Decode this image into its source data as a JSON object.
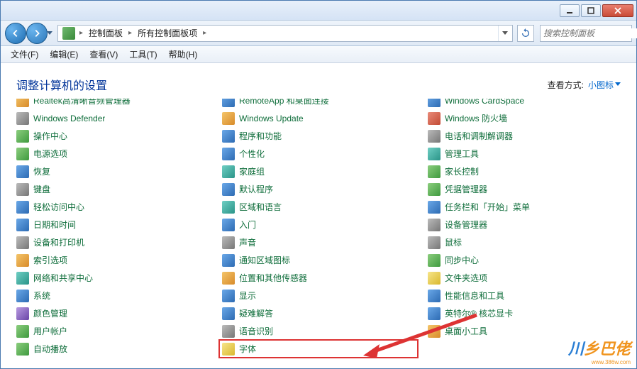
{
  "titlebar": {
    "minimize": "–",
    "maximize": "□",
    "close": "×"
  },
  "nav": {
    "crumb1": "控制面板",
    "crumb2": "所有控制面板项",
    "search_placeholder": "搜索控制面板"
  },
  "menu": {
    "file": "文件(F)",
    "edit": "编辑(E)",
    "view": "查看(V)",
    "tools": "工具(T)",
    "help": "帮助(H)"
  },
  "header": {
    "title": "调整计算机的设置",
    "viewlabel": "查看方式:",
    "viewmode": "小图标"
  },
  "items": [
    {
      "label": "Realtek高清晰音频管理器",
      "icon": "ic-orange",
      "name": "item-realtek-audio"
    },
    {
      "label": "RemoteApp 和桌面连接",
      "icon": "ic-blue",
      "name": "item-remoteapp"
    },
    {
      "label": "Windows CardSpace",
      "icon": "ic-blue",
      "name": "item-cardspace"
    },
    {
      "label": "Windows Defender",
      "icon": "ic-gray",
      "name": "item-defender"
    },
    {
      "label": "Windows Update",
      "icon": "ic-orange",
      "name": "item-update"
    },
    {
      "label": "Windows 防火墙",
      "icon": "ic-red",
      "name": "item-firewall"
    },
    {
      "label": "操作中心",
      "icon": "ic-green",
      "name": "item-action-center"
    },
    {
      "label": "程序和功能",
      "icon": "ic-blue",
      "name": "item-programs"
    },
    {
      "label": "电话和调制解调器",
      "icon": "ic-gray",
      "name": "item-phone-modem"
    },
    {
      "label": "电源选项",
      "icon": "ic-green",
      "name": "item-power"
    },
    {
      "label": "个性化",
      "icon": "ic-blue",
      "name": "item-personalize"
    },
    {
      "label": "管理工具",
      "icon": "ic-teal",
      "name": "item-admin-tools"
    },
    {
      "label": "恢复",
      "icon": "ic-blue",
      "name": "item-recovery"
    },
    {
      "label": "家庭组",
      "icon": "ic-teal",
      "name": "item-homegroup"
    },
    {
      "label": "家长控制",
      "icon": "ic-green",
      "name": "item-parental"
    },
    {
      "label": "键盘",
      "icon": "ic-gray",
      "name": "item-keyboard"
    },
    {
      "label": "默认程序",
      "icon": "ic-blue",
      "name": "item-default-programs"
    },
    {
      "label": "凭据管理器",
      "icon": "ic-green",
      "name": "item-credentials"
    },
    {
      "label": "轻松访问中心",
      "icon": "ic-blue",
      "name": "item-ease-of-access"
    },
    {
      "label": "区域和语言",
      "icon": "ic-teal",
      "name": "item-region-lang"
    },
    {
      "label": "任务栏和「开始」菜单",
      "icon": "ic-blue",
      "name": "item-taskbar"
    },
    {
      "label": "日期和时间",
      "icon": "ic-blue",
      "name": "item-datetime"
    },
    {
      "label": "入门",
      "icon": "ic-blue",
      "name": "item-getting-started"
    },
    {
      "label": "设备管理器",
      "icon": "ic-gray",
      "name": "item-device-manager"
    },
    {
      "label": "设备和打印机",
      "icon": "ic-gray",
      "name": "item-devices-printers"
    },
    {
      "label": "声音",
      "icon": "ic-gray",
      "name": "item-sound"
    },
    {
      "label": "鼠标",
      "icon": "ic-gray",
      "name": "item-mouse"
    },
    {
      "label": "索引选项",
      "icon": "ic-orange",
      "name": "item-indexing"
    },
    {
      "label": "通知区域图标",
      "icon": "ic-blue",
      "name": "item-notification"
    },
    {
      "label": "同步中心",
      "icon": "ic-green",
      "name": "item-sync"
    },
    {
      "label": "网络和共享中心",
      "icon": "ic-teal",
      "name": "item-network"
    },
    {
      "label": "位置和其他传感器",
      "icon": "ic-orange",
      "name": "item-location"
    },
    {
      "label": "文件夹选项",
      "icon": "ic-yellow",
      "name": "item-folder-options"
    },
    {
      "label": "系统",
      "icon": "ic-blue",
      "name": "item-system"
    },
    {
      "label": "显示",
      "icon": "ic-blue",
      "name": "item-display"
    },
    {
      "label": "性能信息和工具",
      "icon": "ic-blue",
      "name": "item-performance"
    },
    {
      "label": "颜色管理",
      "icon": "ic-purple",
      "name": "item-color"
    },
    {
      "label": "疑难解答",
      "icon": "ic-blue",
      "name": "item-troubleshoot"
    },
    {
      "label": "英特尔® 核芯显卡",
      "icon": "ic-blue",
      "name": "item-intel-graphics"
    },
    {
      "label": "用户帐户",
      "icon": "ic-green",
      "name": "item-user-accounts"
    },
    {
      "label": "语音识别",
      "icon": "ic-gray",
      "name": "item-speech"
    },
    {
      "label": "桌面小工具",
      "icon": "ic-orange",
      "name": "item-gadgets"
    },
    {
      "label": "自动播放",
      "icon": "ic-green",
      "name": "item-autoplay"
    },
    {
      "label": "字体",
      "icon": "ic-yellow",
      "name": "item-fonts",
      "highlight": true
    }
  ],
  "watermark": {
    "brand1": "川",
    "brand2": "乡巴佬",
    "url": "www.386w.com"
  }
}
